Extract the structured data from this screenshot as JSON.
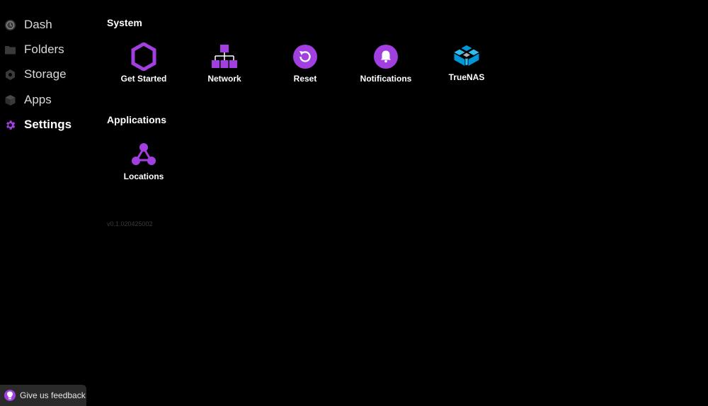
{
  "sidebar": {
    "items": [
      {
        "label": "Dash",
        "icon": "clock-icon"
      },
      {
        "label": "Folders",
        "icon": "folder-icon"
      },
      {
        "label": "Storage",
        "icon": "hexagon-icon"
      },
      {
        "label": "Apps",
        "icon": "cube-icon"
      },
      {
        "label": "Settings",
        "icon": "gear-icon",
        "active": true
      }
    ]
  },
  "main": {
    "system_title": "System",
    "system_tiles": [
      {
        "label": "Get Started",
        "icon": "hexagon-outline-icon"
      },
      {
        "label": "Network",
        "icon": "network-tree-icon"
      },
      {
        "label": "Reset",
        "icon": "reset-icon"
      },
      {
        "label": "Notifications",
        "icon": "bell-icon"
      },
      {
        "label": "TrueNAS",
        "icon": "truenas-logo-icon"
      }
    ],
    "applications_title": "Applications",
    "application_tiles": [
      {
        "label": "Locations",
        "icon": "locations-icon"
      }
    ],
    "version": "v0.1.020425002"
  },
  "feedback": {
    "label": "Give us feedback",
    "icon": "lightbulb-icon"
  },
  "colors": {
    "accent": "#a23fe0",
    "truenas_blue": "#0095d5",
    "background": "#000000"
  }
}
